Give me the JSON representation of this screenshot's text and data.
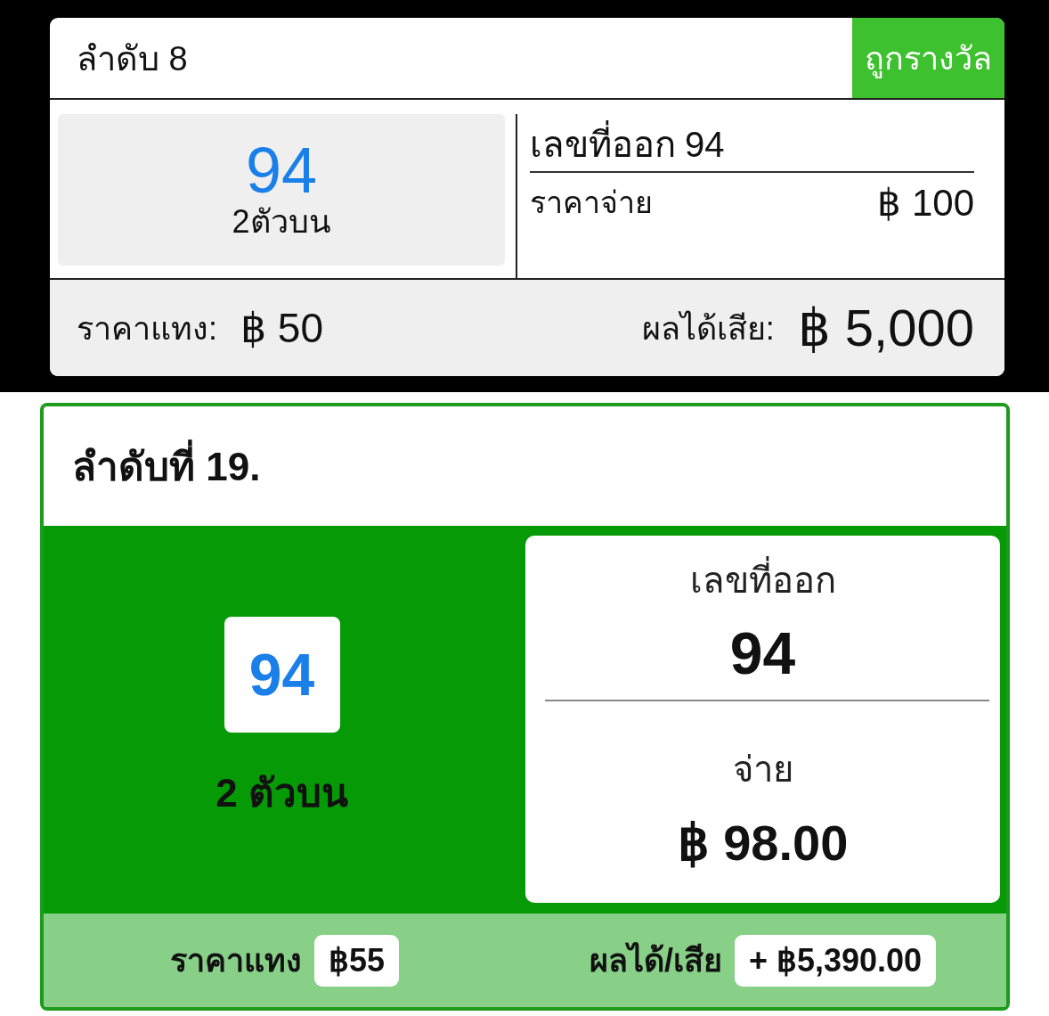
{
  "cards": [
    {
      "kind": "classic",
      "title": "ลำดับ 8",
      "status": "ถูกรางวัล",
      "bet": {
        "number": "94",
        "type": "2ตัวบน"
      },
      "draw": {
        "label": "เลขที่ออก",
        "number": "94"
      },
      "payout": {
        "label": "ราคาจ่าย",
        "amount": "฿ 100"
      },
      "stake": {
        "label": "ราคาแทง:",
        "amount": "฿ 50"
      },
      "result": {
        "label": "ผลได้เสีย:",
        "amount": "฿ 5,000"
      }
    },
    {
      "kind": "green",
      "title": "ลำดับที่ 19.",
      "bet": {
        "number": "94",
        "type": "2 ตัวบน"
      },
      "draw": {
        "label": "เลขที่ออก",
        "number": "94"
      },
      "payout": {
        "label": "จ่าย",
        "amount": "฿ 98.00"
      },
      "stake": {
        "label": "ราคาแทง",
        "amount": "฿55"
      },
      "result": {
        "label": "ผลได้/เสีย",
        "amount": "+ ฿5,390.00"
      }
    }
  ]
}
